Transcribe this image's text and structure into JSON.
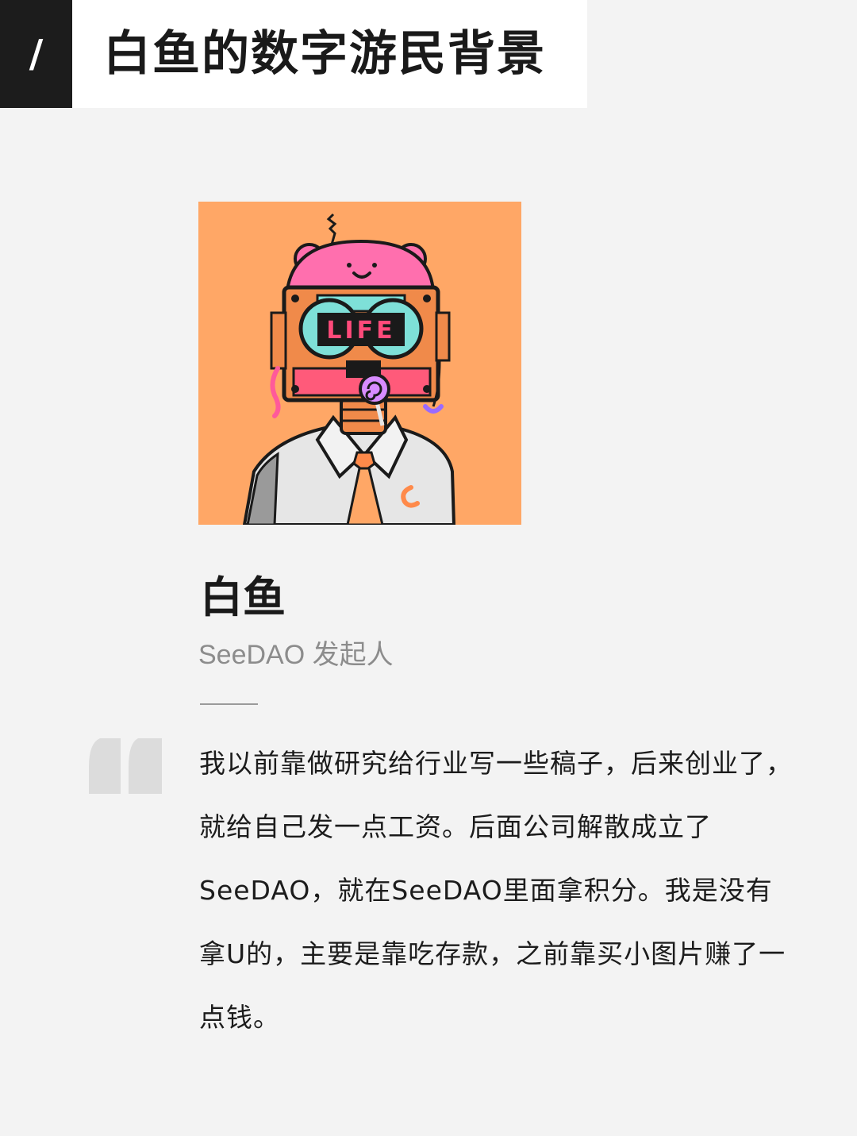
{
  "header": {
    "slash": "/",
    "title": "白鱼的数字游民背景"
  },
  "avatar": {
    "icon": "robot-avatar-illustration",
    "background_color": "#ffa766",
    "glasses_text": "LIFE"
  },
  "profile": {
    "name": "白鱼",
    "role": "SeeDAO 发起人"
  },
  "quote": {
    "icon": "quote-mark-icon",
    "text": "我以前靠做研究给行业写一些稿子，后来创业了，就给自己发一点工资。后面公司解散成立了SeeDAO，就在SeeDAO里面拿积分。我是没有拿U的，主要是靠吃存款，之前靠买小图片赚了一点钱。"
  }
}
